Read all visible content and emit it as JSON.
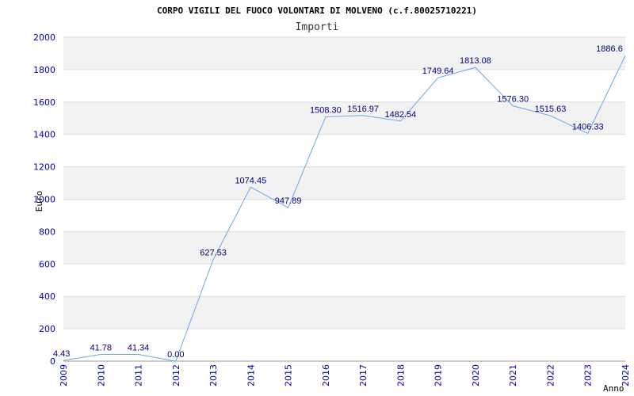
{
  "chart_data": {
    "type": "line",
    "title": "CORPO VIGILI DEL FUOCO VOLONTARI DI MOLVENO (c.f.80025710221)",
    "subtitle": "Importi",
    "xlabel": "Anno",
    "ylabel": "Euro",
    "ylim": [
      0,
      2000
    ],
    "yticks": [
      0,
      200,
      400,
      600,
      800,
      1000,
      1200,
      1400,
      1600,
      1800,
      2000
    ],
    "grid": true,
    "categories": [
      "2009",
      "2010",
      "2011",
      "2012",
      "2013",
      "2014",
      "2015",
      "2016",
      "2017",
      "2018",
      "2019",
      "2020",
      "2021",
      "2022",
      "2023",
      "2024"
    ],
    "values": [
      4.43,
      41.78,
      41.34,
      0.0,
      627.53,
      1074.45,
      947.89,
      1508.3,
      1516.97,
      1482.54,
      1749.64,
      1813.08,
      1576.3,
      1515.63,
      1406.33,
      1886.6
    ],
    "labels": [
      "4.43",
      "41.78",
      "41.34",
      "0.00",
      "627.53",
      "1074.45",
      "947.89",
      "1508.30",
      "1516.97",
      "1482.54",
      "1749.64",
      "1813.08",
      "1576.30",
      "1515.63",
      "1406.33",
      "1886.6"
    ],
    "colors": {
      "line": "#6aa6e8",
      "tick_text": "#0000aa",
      "band": "#f2f2f2",
      "gridline": "#dddddd"
    }
  }
}
